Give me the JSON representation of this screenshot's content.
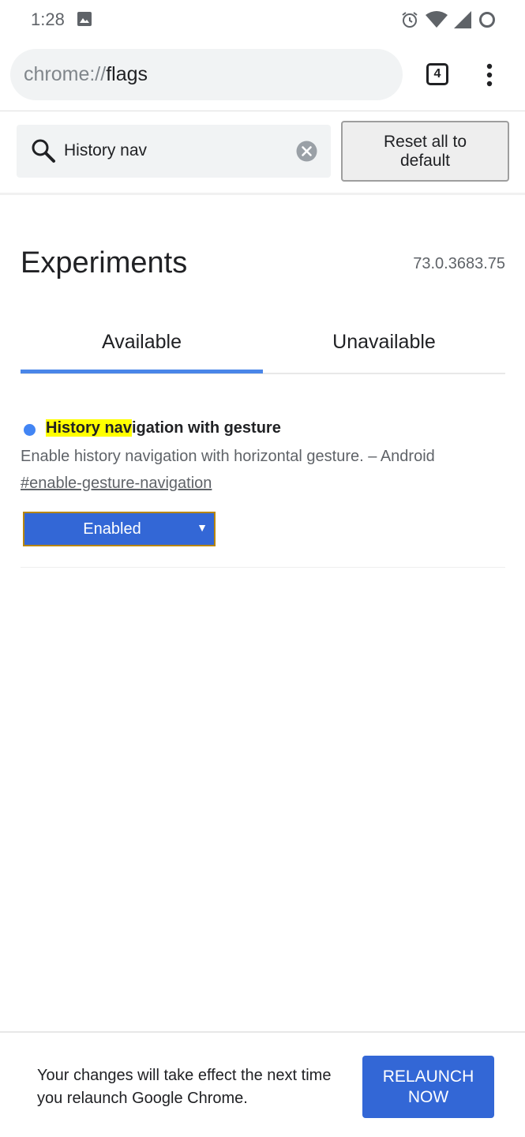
{
  "status_bar": {
    "time": "1:28",
    "icons": [
      "gallery-icon",
      "alarm-icon",
      "wifi-icon",
      "signal-icon",
      "battery-icon"
    ]
  },
  "browser": {
    "url_scheme": "chrome://",
    "url_host": "flags",
    "tab_count": "4"
  },
  "search": {
    "value": "History nav",
    "reset_label_line1": "Reset all to",
    "reset_label_line2": "default"
  },
  "main": {
    "title": "Experiments",
    "version": "73.0.3683.75",
    "tabs": [
      {
        "label": "Available",
        "selected": true
      },
      {
        "label": "Unavailable",
        "selected": false
      }
    ]
  },
  "experiment": {
    "title_match": "History nav",
    "title_rest": "igation with gesture",
    "description": "Enable history navigation with horizontal gesture. – Android",
    "anchor": "#enable-gesture-navigation",
    "selected_option": "Enabled"
  },
  "relaunch": {
    "message": "Your changes will take effect the next time you relaunch Google Chrome.",
    "button_line1": "RELAUNCH",
    "button_line2": "NOW"
  },
  "colors": {
    "accent": "#3367d6",
    "tab_indicator": "#4a86e8",
    "highlight": "#ffff00"
  }
}
